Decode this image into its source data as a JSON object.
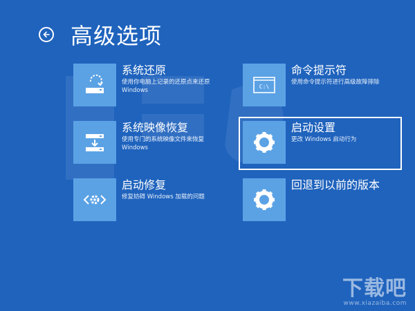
{
  "header": {
    "title": "高级选项",
    "back_icon": "back-arrow-icon"
  },
  "options": [
    {
      "title": "系统还原",
      "desc": "使用你电脑上记录的还原点来还原 Windows",
      "icon": "system-restore-icon"
    },
    {
      "title": "系统映像恢复",
      "desc": "使用专门的系统映像文件来恢复 Windows",
      "icon": "system-image-icon"
    },
    {
      "title": "启动修复",
      "desc": "修复妨碍 Windows 加载的问题",
      "icon": "startup-repair-icon"
    },
    {
      "title": "命令提示符",
      "desc": "使用命令提示符进行高级故障排除",
      "icon": "command-prompt-icon",
      "icon_text": "C:\\"
    },
    {
      "title": "启动设置",
      "desc": "更改 Windows 启动行为",
      "icon": "gear-icon"
    },
    {
      "title": "回退到以前的版本",
      "desc": "",
      "icon": "gear-icon"
    }
  ],
  "watermark": {
    "logo": "下载吧",
    "url": "www.xiazaiba.com"
  },
  "colors": {
    "background": "#1f63bd",
    "tile": "#5ba2e5",
    "text": "#ffffff"
  }
}
